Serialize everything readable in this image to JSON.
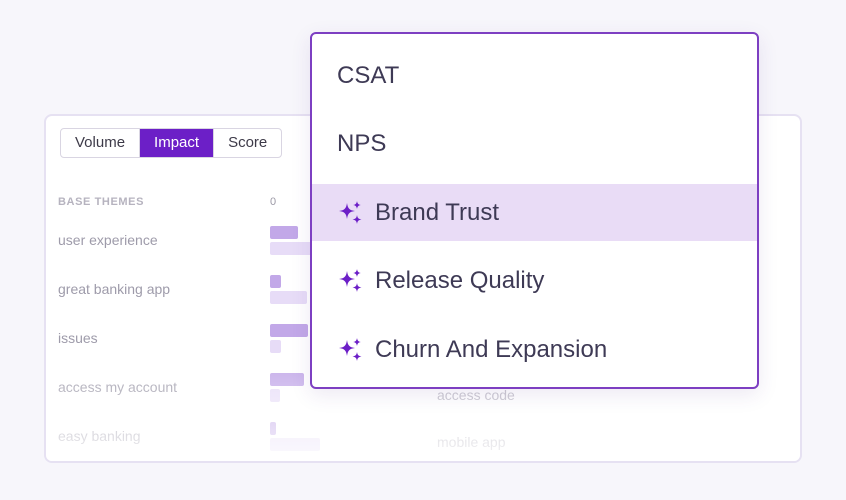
{
  "view_toggle": {
    "options": [
      {
        "label": "Volume",
        "active": false
      },
      {
        "label": "Impact",
        "active": true
      },
      {
        "label": "Score",
        "active": false
      }
    ]
  },
  "table": {
    "column_header": "BASE THEMES",
    "axis_zero": "0",
    "rows": [
      {
        "label": "user experience",
        "bar1": 0.45,
        "bar2": 0.7
      },
      {
        "label": "great banking app",
        "bar1": 0.18,
        "bar2": 0.6
      },
      {
        "label": "issues",
        "bar1": 0.62,
        "bar2": 0.18
      },
      {
        "label": "access my account",
        "bar1": 0.55,
        "bar2": 0.16
      },
      {
        "label": "easy banking",
        "bar1": 0.1,
        "bar2": 0.8
      }
    ],
    "right_labels": [
      "access code",
      "mobile app"
    ]
  },
  "metric_dropdown": {
    "selected_index": 2,
    "options": [
      {
        "label": "CSAT",
        "icon": null
      },
      {
        "label": "NPS",
        "icon": null
      },
      {
        "label": "Brand Trust",
        "icon": "sparkle-icon"
      },
      {
        "label": "Release Quality",
        "icon": "sparkle-icon"
      },
      {
        "label": "Churn And Expansion",
        "icon": "sparkle-icon"
      }
    ]
  },
  "colors": {
    "accent": "#6c1fc7",
    "dropdown_border": "#7d3fc2",
    "selected_bg": "#e9dcf6",
    "bar_dark": "#c2a8e8",
    "bar_light": "#e7dcf7"
  }
}
